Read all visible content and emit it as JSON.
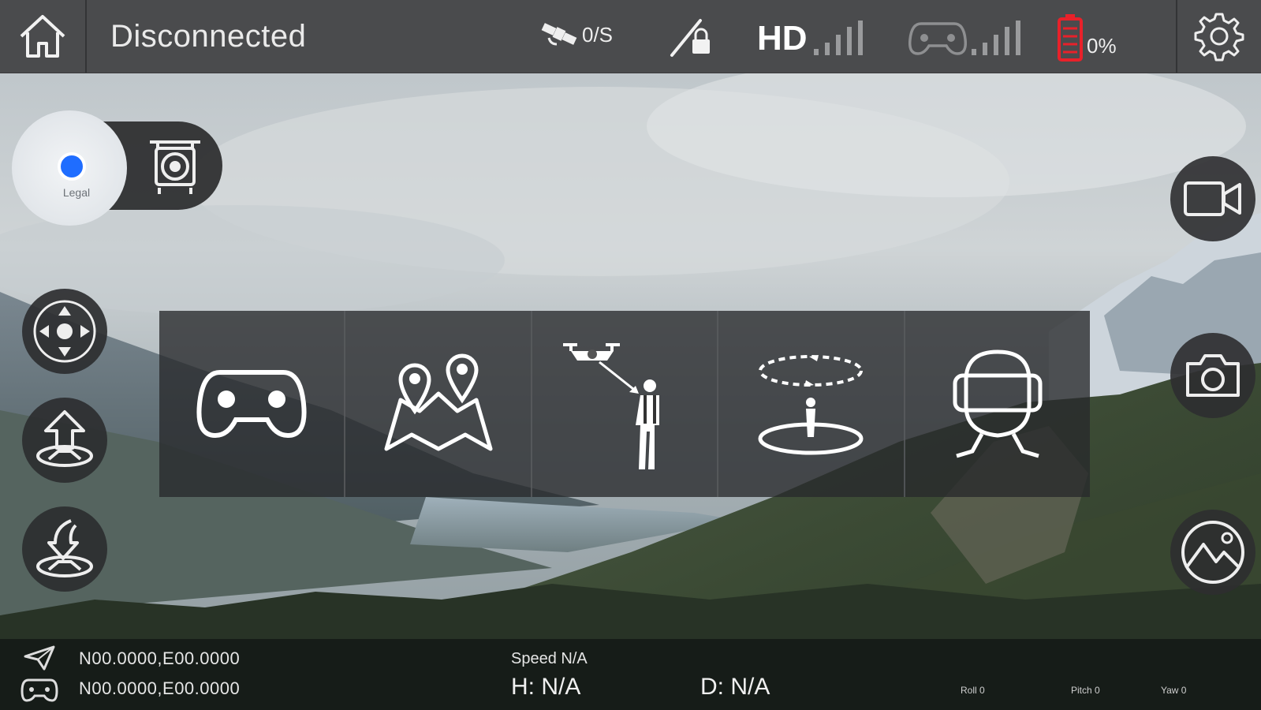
{
  "top_bar": {
    "home_icon": "home-icon",
    "connection_status": "Disconnected",
    "satellite_icon": "satellite-icon",
    "satellite_count": "0/S",
    "compass_lock_icon": "compass-lock-icon",
    "video_label": "HD",
    "video_signal_icon": "signal-bars-icon",
    "controller_icon": "gamepad-icon",
    "controller_signal_icon": "signal-bars-icon",
    "battery_icon": "battery-icon",
    "battery_percent": "0%",
    "battery_color": "#e8212a",
    "settings_icon": "gear-icon"
  },
  "map_widget": {
    "label": "Legal"
  },
  "left_controls": [
    {
      "name": "direction-pad-button",
      "icon": "dpad-icon"
    },
    {
      "name": "takeoff-button",
      "icon": "takeoff-icon"
    },
    {
      "name": "return-home-button",
      "icon": "return-home-icon"
    }
  ],
  "flight_modes": [
    {
      "name": "manual-mode",
      "icon": "gamepad-icon"
    },
    {
      "name": "waypoint-mode",
      "icon": "map-pins-icon"
    },
    {
      "name": "follow-me-mode",
      "icon": "follow-me-icon"
    },
    {
      "name": "orbit-mode",
      "icon": "orbit-icon"
    },
    {
      "name": "vr-mode",
      "icon": "vr-headset-icon"
    }
  ],
  "right_controls": [
    {
      "name": "record-video-button",
      "icon": "video-camera-icon"
    },
    {
      "name": "take-photo-button",
      "icon": "camera-icon"
    },
    {
      "name": "gallery-button",
      "icon": "gallery-icon"
    }
  ],
  "telemetry": {
    "drone_coords": "N00.0000,E00.0000",
    "controller_coords": "N00.0000,E00.0000",
    "speed": "Speed N/A",
    "height": "H: N/A",
    "distance": "D: N/A",
    "roll": "Roll 0",
    "pitch": "Pitch 0",
    "yaw": "Yaw 0"
  },
  "colors": {
    "top_bar": "#4a4b4d",
    "map_dot": "#1f6dff",
    "panel": "#28292b"
  }
}
